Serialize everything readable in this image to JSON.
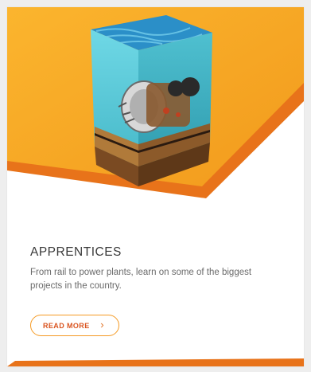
{
  "card": {
    "title": "APPRENTICES",
    "description": "From rail to power plants, learn on some of the biggest projects in the country.",
    "button_label": "READ MORE",
    "button_icon": "chevron-right-icon",
    "chevron_glyph": "›"
  },
  "colors": {
    "orange_light": "#f6a623",
    "orange_dark": "#e8731a",
    "accent_text": "#d9531e",
    "water": "#4fc4d4"
  }
}
